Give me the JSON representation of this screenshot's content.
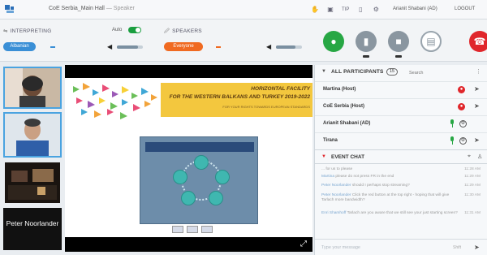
{
  "topbar": {
    "title": "CoE Serbia_Main Hall",
    "role": "— Speaker",
    "icons": [
      "hand-icon",
      "layout-icon",
      "tips-label",
      "copy-icon",
      "gear-icon"
    ],
    "tips_label": "TIP",
    "username": "Arianit Shabani (AD)",
    "logout_label": "LOGOUT"
  },
  "controls": {
    "interpreting_label": "INTERPRETING",
    "auto_label": "Auto",
    "auto_on": true,
    "interpreting_language": "Albanian",
    "speakers_label": "SPEAKERS",
    "speakers_language": "Everyone",
    "interp_volume": 0.8,
    "speakers_volume": 0.75,
    "colors": {
      "green": "#27a744",
      "red": "#e0262b",
      "blue": "#3a8fd6",
      "orange": "#f06a21"
    }
  },
  "tiles": {
    "name_tile": "Peter Noorlander"
  },
  "slide": {
    "line1": "HORIZONTAL FACILITY",
    "line2": "FOR THE WESTERN BALKANS AND TURKEY 2019-2022",
    "line3": "FOR YOUR RIGHTS TOWARDS EUROPEAN STANDARDS"
  },
  "participants": {
    "header_label": "ALL PARTICIPANTS",
    "count": "15",
    "search_placeholder": "Search",
    "rows": [
      {
        "name": "Martina (Host)"
      },
      {
        "name": "CoE Serbia (Host)"
      },
      {
        "name": "Arianit Shabani (AD)"
      },
      {
        "name": "Tirana"
      }
    ]
  },
  "chat": {
    "header_label": "EVENT CHAT",
    "messages": [
      {
        "who": "",
        "text": "... for us to please",
        "time": "11:28 AM"
      },
      {
        "who": "Martina",
        "text": "please do not press FR in the end",
        "time": "11:29 AM"
      },
      {
        "who": "Peter Noorlander",
        "text": "should I perhaps stop streaming?",
        "time": "11:29 AM"
      },
      {
        "who": "Peter Noorlander",
        "text": "Click the red button at the top right - hoping that will give Tarlach more bandwidth?",
        "time": "11:30 AM"
      },
      {
        "who": "Enri Shamhoff",
        "text": "Tarlach are you aware that we still see your just starting screen?",
        "time": "11:31 AM"
      }
    ],
    "input_placeholder": "Type your message",
    "shift_hint": "Shift"
  }
}
